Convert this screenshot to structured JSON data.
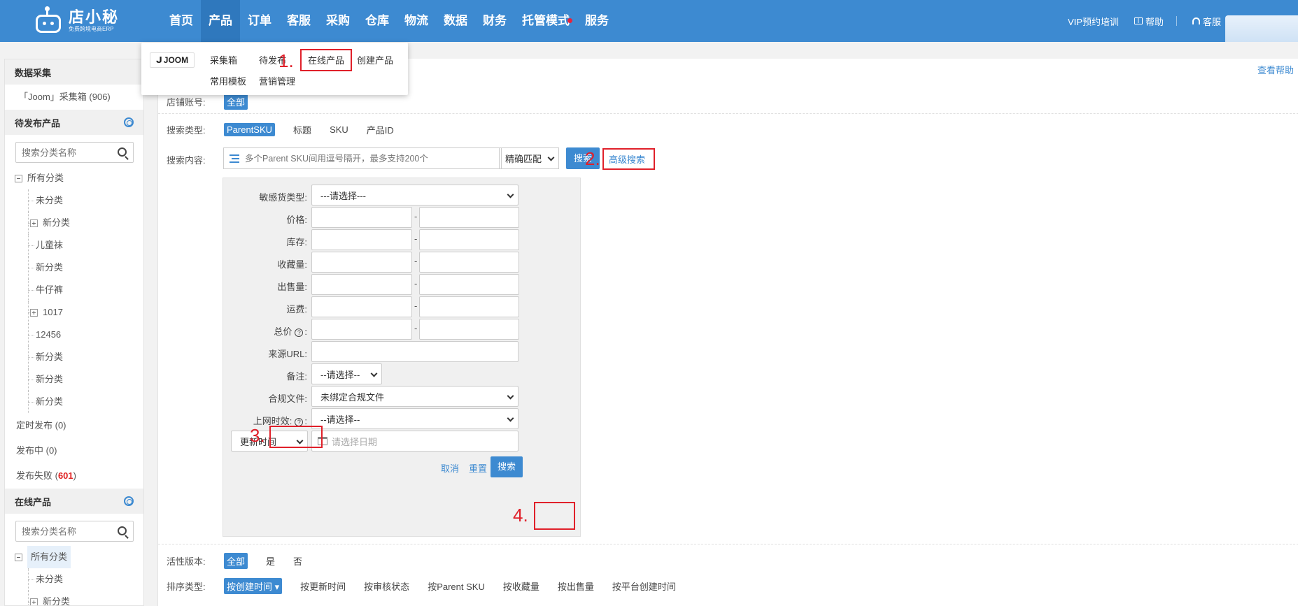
{
  "app": {
    "logo_title": "店小秘",
    "logo_subtitle": "免费跨境电商ERP"
  },
  "nav": {
    "items": [
      {
        "label": "首页"
      },
      {
        "label": "产品"
      },
      {
        "label": "订单"
      },
      {
        "label": "客服"
      },
      {
        "label": "采购"
      },
      {
        "label": "仓库"
      },
      {
        "label": "物流"
      },
      {
        "label": "数据"
      },
      {
        "label": "财务"
      },
      {
        "label": "托管模式"
      },
      {
        "label": "服务"
      }
    ],
    "active_index": 1,
    "vip_training": "VIP预约培训",
    "help": "帮助",
    "customer_service": "客服"
  },
  "dropdown": {
    "platform": "JOOM",
    "items": [
      "采集箱",
      "待发布",
      "在线产品",
      "创建产品",
      "常用模板",
      "营销管理"
    ]
  },
  "sidebar": {
    "data_collect_title": "数据采集",
    "joom_collect_box": "「Joom」采集箱 (906)",
    "pending_title": "待发布产品",
    "search_placeholder": "搜索分类名称",
    "pending_tree": {
      "root": "所有分类",
      "children": [
        "未分类",
        "新分类",
        "儿童袜",
        "新分类",
        "牛仔裤",
        "1017",
        "12456",
        "新分类",
        "新分类",
        "新分类"
      ]
    },
    "scheduled": "定时发布 (0)",
    "publishing": "发布中 (0)",
    "failed_prefix": "发布失败 (",
    "failed_count": "601",
    "failed_suffix": ")",
    "online_title": "在线产品",
    "online_tree": {
      "root": "所有分类",
      "children": [
        "未分类",
        "新分类"
      ]
    }
  },
  "main": {
    "help_link": "查看帮助",
    "shop_label": "店铺账号:",
    "shop_all": "全部",
    "search_type_label": "搜索类型:",
    "search_types": [
      "ParentSKU",
      "标题",
      "SKU",
      "产品ID"
    ],
    "search_content_label": "搜索内容:",
    "search_placeholder": "多个Parent SKU间用逗号隔开，最多支持200个",
    "match_mode": "精确匹配",
    "search_button": "搜索",
    "advanced_search": "高级搜索",
    "active_version_label": "活性版本:",
    "active_versions": [
      "全部",
      "是",
      "否"
    ],
    "sort_label": "排序类型:",
    "sort_options": [
      "按创建时间",
      "按更新时间",
      "按审核状态",
      "按Parent SKU",
      "按收藏量",
      "按出售量",
      "按平台创建时间"
    ]
  },
  "advanced": {
    "sensitive_label": "敏感货类型:",
    "sensitive_value": "---请选择---",
    "price_label": "价格:",
    "stock_label": "库存:",
    "favorites_label": "收藏量:",
    "sold_label": "出售量:",
    "shipping_label": "运费:",
    "total_label": "总价",
    "total_colon": ":",
    "source_url_label": "来源URL:",
    "remark_label": "备注:",
    "remark_value": "--请选择--",
    "compliance_label": "合规文件:",
    "compliance_value": "未绑定合规文件",
    "online_time_label": "上网时效:",
    "online_time_value": "--请选择--",
    "date_type": "更新时间",
    "date_placeholder": "请选择日期",
    "cancel": "取消",
    "reset": "重置",
    "search": "搜索",
    "range_dash": "-"
  },
  "annotations": {
    "step1": "1.",
    "step2": "2.",
    "step3": "3.",
    "step4": "4."
  },
  "colors": {
    "brand_blue": "#3d8ad1",
    "annotation_red": "#e0202a"
  }
}
